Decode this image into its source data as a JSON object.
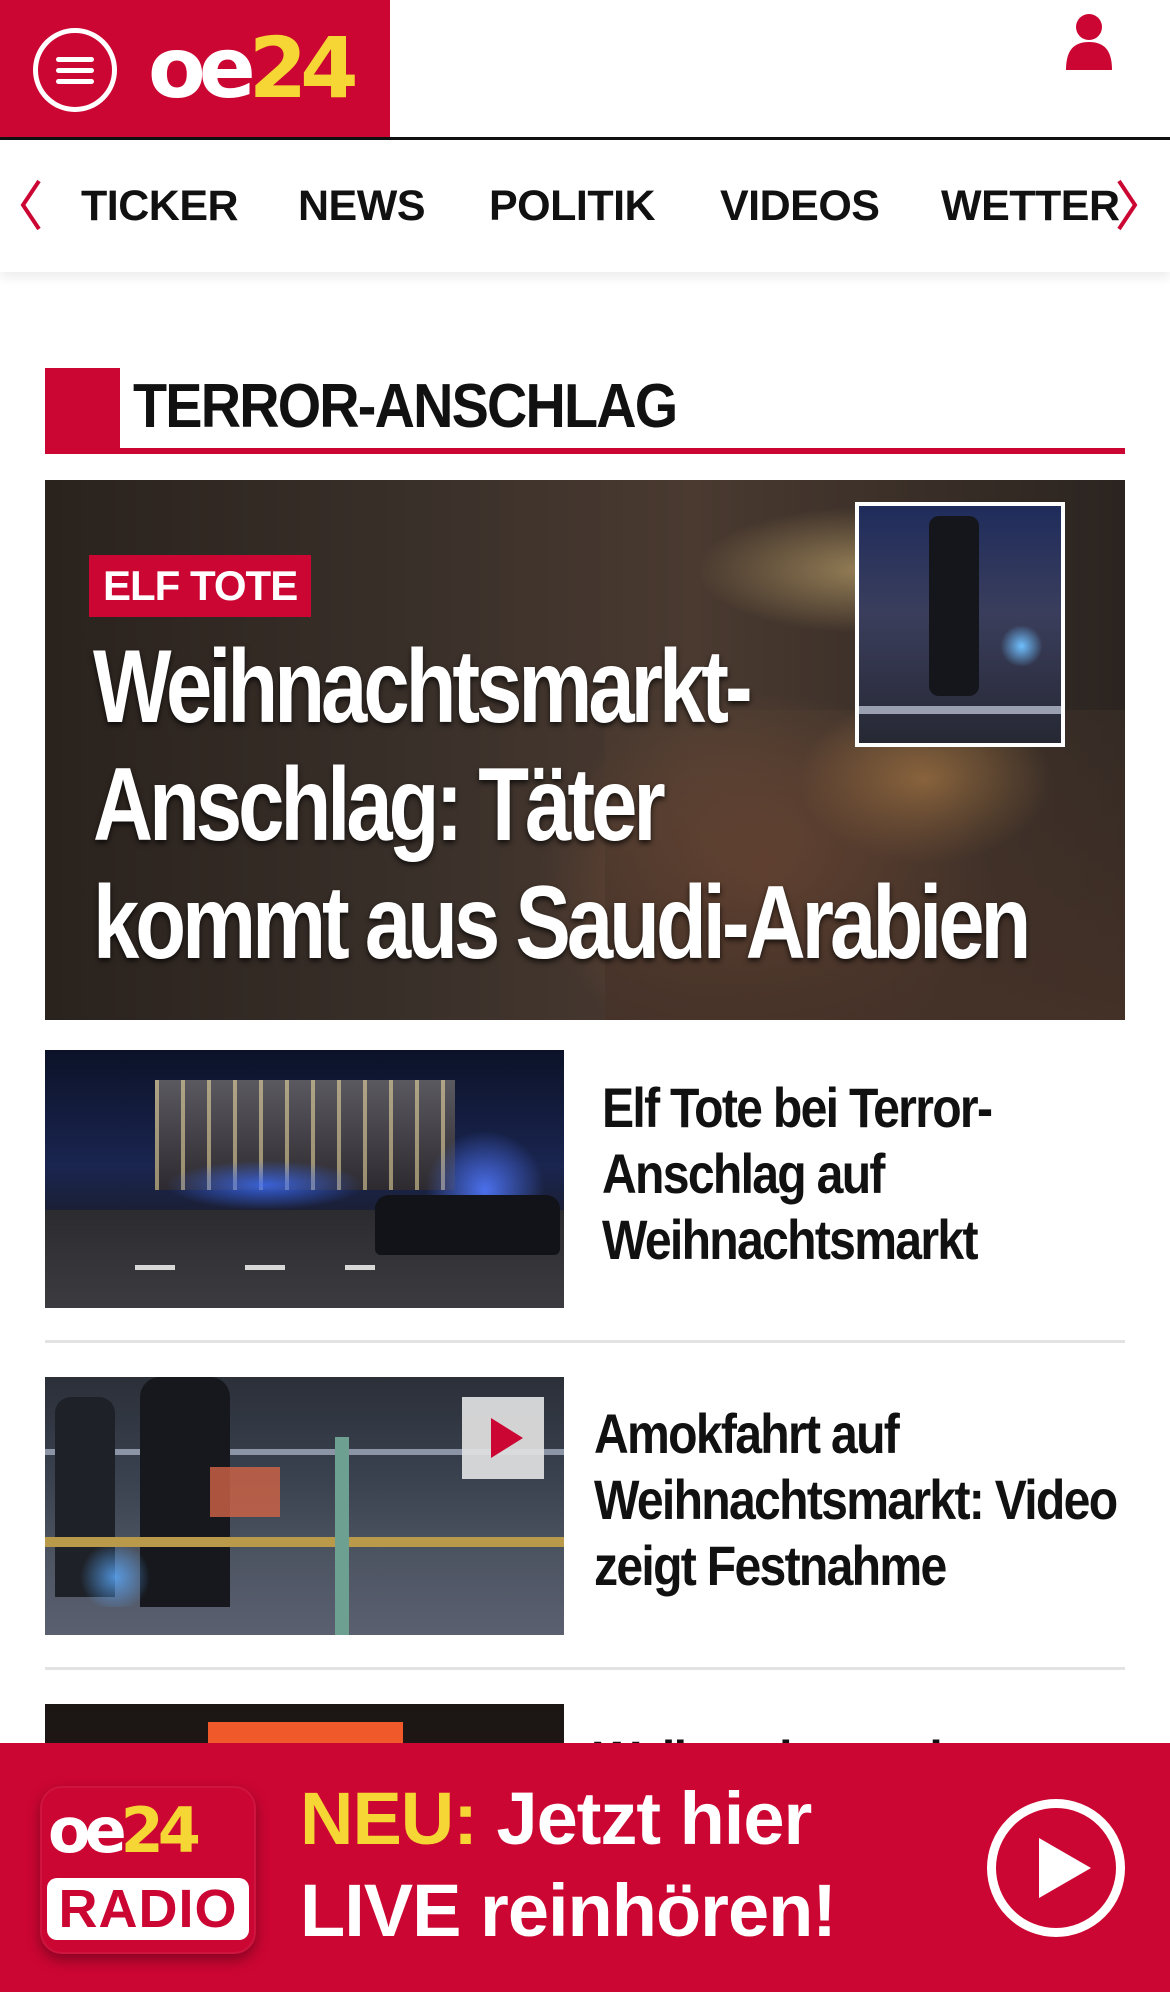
{
  "header": {
    "logo_oe": "oe",
    "logo_num": "24",
    "menu_icon": "hamburger-menu-icon",
    "user_icon": "user-icon",
    "brand_color": "#cc0633",
    "accent_color": "#f6d634"
  },
  "nav": {
    "items": [
      {
        "label": "TICKER"
      },
      {
        "label": "NEWS"
      },
      {
        "label": "POLITIK"
      },
      {
        "label": "VIDEOS"
      },
      {
        "label": "WETTER"
      }
    ],
    "prev_icon": "chevron-left-icon",
    "next_icon": "chevron-right-icon"
  },
  "section": {
    "title": "TERROR-ANSCHLAG"
  },
  "hero": {
    "badge": "ELF TOTE",
    "title_line1": "Weihnachtsmarkt-",
    "title_line2": "Anschlag: Täter",
    "title_line3": "kommt aus Saudi-Arabien"
  },
  "articles": [
    {
      "line1": "Elf Tote bei Terror-",
      "line2": "Anschlag auf",
      "line3": "Weihnachtsmarkt"
    },
    {
      "line1": "Amokfahrt auf",
      "line2": "Weihnachtsmarkt: Video",
      "line3": "zeigt Festnahme",
      "has_video": true
    },
    {
      "line1": "Weihnachtsmarkt-",
      "line2": "",
      "line3": ""
    }
  ],
  "radio": {
    "logo_oe": "oe",
    "logo_num": "24",
    "logo_label": "RADIO",
    "highlight": "NEU:",
    "text1": " Jetzt hier",
    "text2": "LIVE reinhören!",
    "play_icon": "play-circle-icon"
  }
}
